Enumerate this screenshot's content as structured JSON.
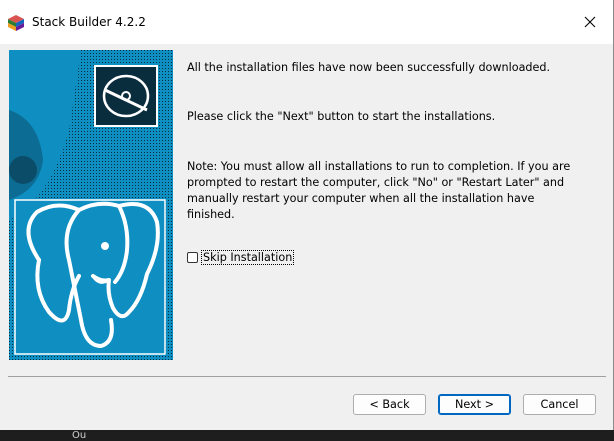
{
  "window": {
    "title": "Stack Builder 4.2.2"
  },
  "content": {
    "message_downloaded": "All the installation files have now been successfully downloaded.",
    "message_next": "Please click the \"Next\" button to start the installations.",
    "message_note": "Note: You must allow all installations to run to completion. If you are prompted to restart the computer, click \"No\" or \"Restart Later\" and manually restart your computer when all the installation have finished.",
    "skip_installation_label": "Skip Installation",
    "skip_installation_checked": false
  },
  "buttons": {
    "back_label": "< Back",
    "next_label": "Next >",
    "cancel_label": "Cancel"
  },
  "icons": {
    "app": "stack-builder-icon",
    "close": "close-icon",
    "disc": "disc-icon",
    "elephant": "postgresql-elephant-logo"
  },
  "colors": {
    "banner_blue": "#0f8ec2",
    "banner_dark": "#0a2d3e",
    "accent": "#0067c0"
  },
  "taskbar": {
    "hint_text": "Ou"
  }
}
